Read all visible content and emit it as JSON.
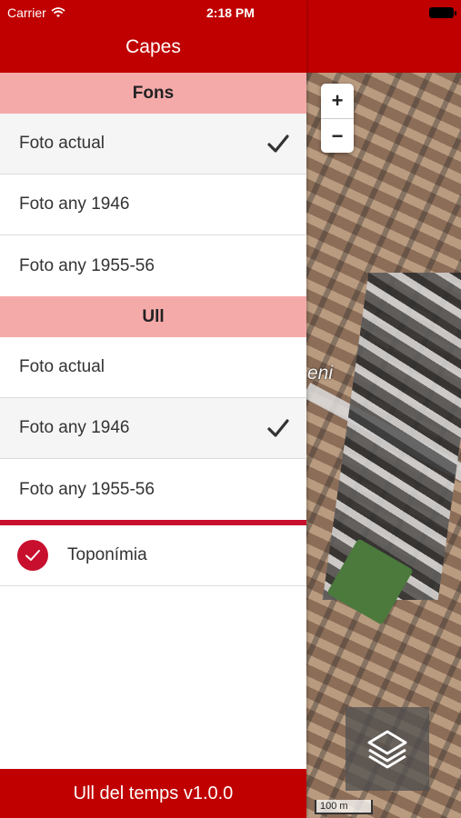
{
  "status_bar": {
    "carrier": "Carrier",
    "time": "2:18 PM",
    "wifi_icon": "wifi-icon",
    "battery_icon": "battery-icon"
  },
  "panel": {
    "title": "Capes",
    "sections": [
      {
        "heading": "Fons",
        "items": [
          {
            "label": "Foto actual",
            "checked": true
          },
          {
            "label": "Foto any 1946",
            "checked": false
          },
          {
            "label": "Foto any 1955-56",
            "checked": false
          }
        ]
      },
      {
        "heading": "Ull",
        "items": [
          {
            "label": "Foto actual",
            "checked": false
          },
          {
            "label": "Foto any 1946",
            "checked": true
          },
          {
            "label": "Foto any 1955-56",
            "checked": false
          }
        ]
      }
    ],
    "toponymy": {
      "label": "Toponímia",
      "checked": true
    },
    "footer": "Ull del temps v1.0.0"
  },
  "map": {
    "zoom_in": "+",
    "zoom_out": "−",
    "place_label": "eni",
    "scale": "100 m",
    "layers_icon": "layers-icon"
  },
  "colors": {
    "brand_red": "#c00000",
    "section_pink": "#f5aaaa",
    "accent_red": "#c8102e"
  }
}
